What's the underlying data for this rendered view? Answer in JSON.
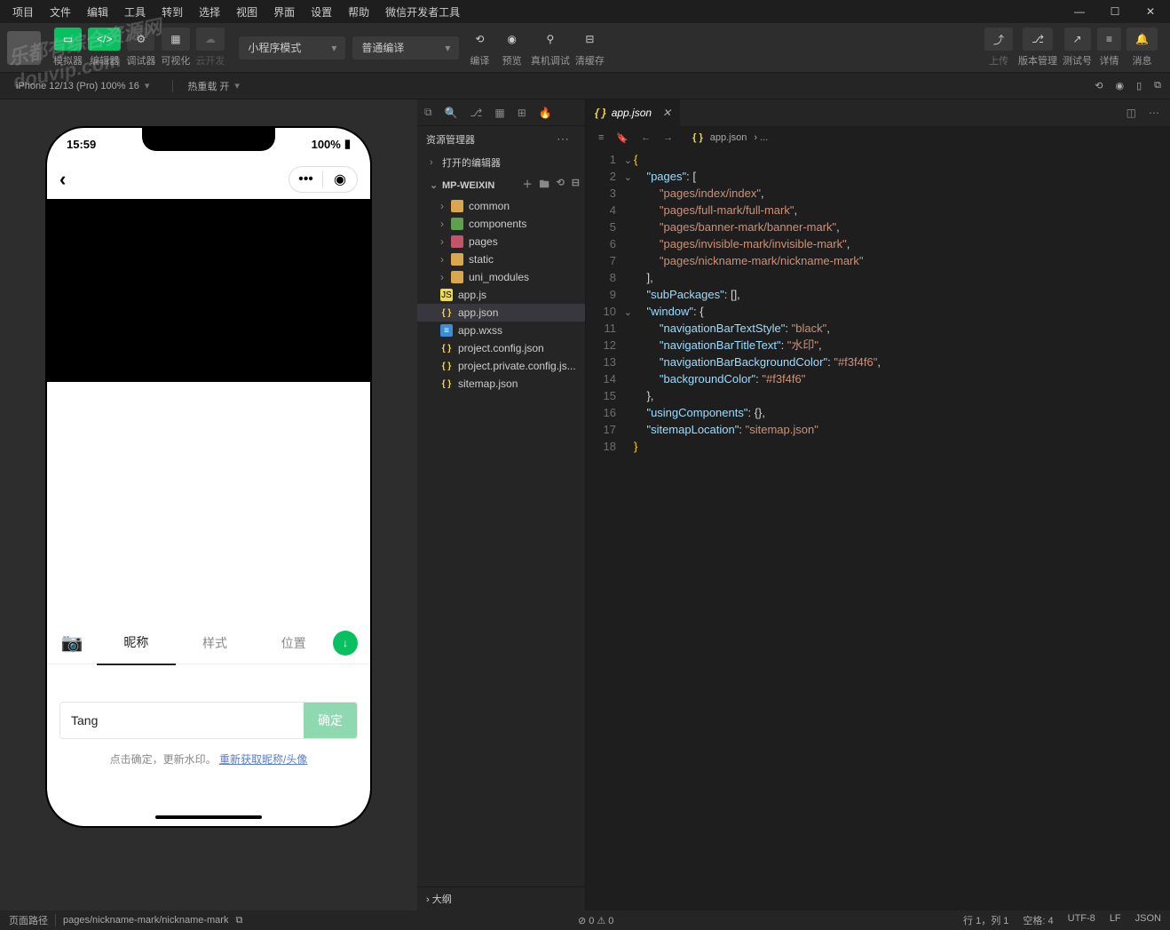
{
  "menu": [
    "项目",
    "文件",
    "编辑",
    "工具",
    "转到",
    "选择",
    "视图",
    "界面",
    "设置",
    "帮助",
    "微信开发者工具"
  ],
  "toolbar": {
    "simulator": "模拟器",
    "editor": "编辑器",
    "debugger": "调试器",
    "visual": "可视化",
    "cloud": "云开发",
    "mode": "小程序模式",
    "compile_mode": "普通编译",
    "compile": "编译",
    "preview": "预览",
    "remote": "真机调试",
    "cache": "清缓存",
    "upload": "上传",
    "version": "版本管理",
    "testno": "测试号",
    "detail": "详情",
    "message": "消息"
  },
  "secondbar": {
    "device": "iPhone 12/13 (Pro)  100%  16",
    "hotreload": "热重载 开"
  },
  "simulator": {
    "time": "15:59",
    "battery": "100%",
    "tabs": {
      "nickname": "昵称",
      "style": "样式",
      "position": "位置"
    },
    "input_value": "Tang",
    "confirm": "确定",
    "hint1": "点击确定，更新水印。",
    "hint_link": "重新获取昵称/头像"
  },
  "explorer": {
    "title": "资源管理器",
    "opened": "打开的编辑器",
    "project": "MP-WEIXIN",
    "folders": [
      "common",
      "components",
      "pages",
      "static",
      "uni_modules"
    ],
    "files": {
      "appjs": "app.js",
      "appjson": "app.json",
      "appwxss": "app.wxss",
      "projcfg": "project.config.json",
      "projpriv": "project.private.config.js...",
      "sitemap": "sitemap.json"
    },
    "outline": "大纲"
  },
  "tab": {
    "filename": "app.json"
  },
  "breadcrumb": {
    "file": "app.json",
    "sep": "› ..."
  },
  "code": {
    "l1": "{",
    "l2_k": "\"pages\"",
    "l2_v": ": [",
    "l3": "\"pages/index/index\"",
    "l4": "\"pages/full-mark/full-mark\"",
    "l5": "\"pages/banner-mark/banner-mark\"",
    "l6": "\"pages/invisible-mark/invisible-mark\"",
    "l7": "\"pages/nickname-mark/nickname-mark\"",
    "l8": "],",
    "l9_k": "\"subPackages\"",
    "l9_v": ": [],",
    "l10_k": "\"window\"",
    "l10_v": ": {",
    "l11_k": "\"navigationBarTextStyle\"",
    "l11_v": "\"black\"",
    "l12_k": "\"navigationBarTitleText\"",
    "l12_v": "\"水印\"",
    "l13_k": "\"navigationBarBackgroundColor\"",
    "l13_v": "\"#f3f4f6\"",
    "l14_k": "\"backgroundColor\"",
    "l14_v": "\"#f3f4f6\"",
    "l15": "},",
    "l16_k": "\"usingComponents\"",
    "l16_v": ": {},",
    "l17_k": "\"sitemapLocation\"",
    "l17_v": "\"sitemap.json\"",
    "l18": "}"
  },
  "status": {
    "path_label": "页面路径",
    "path": "pages/nickname-mark/nickname-mark",
    "errwarn": "⊘ 0 ⚠ 0",
    "pos": "行 1，列 1",
    "spaces": "空格: 4",
    "enc": "UTF-8",
    "eol": "LF",
    "lang": "JSON"
  }
}
